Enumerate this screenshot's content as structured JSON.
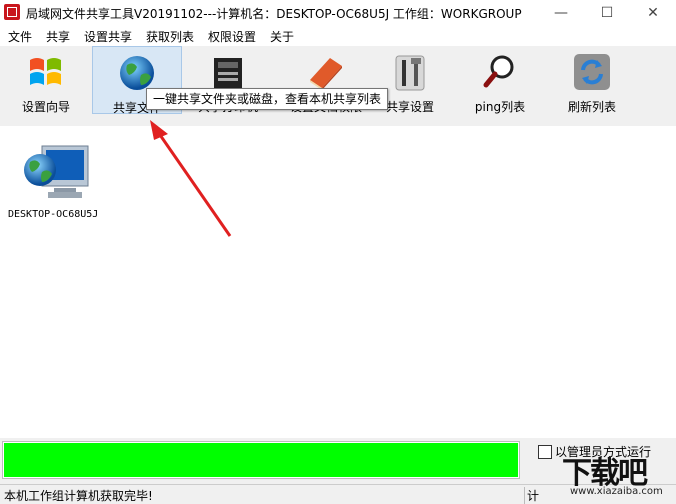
{
  "window": {
    "title": "局域网文件共享工具V20191102---计算机名：DESKTOP-OC68U5J  工作组：WORKGROUP",
    "minimize_glyph": "—",
    "maximize_glyph": "☐",
    "close_glyph": "✕"
  },
  "menu": {
    "items": [
      "文件",
      "共享",
      "设置共享",
      "获取列表",
      "权限设置",
      "关于"
    ]
  },
  "toolbar": {
    "items": [
      {
        "label": "设置向导",
        "icon": "windows-logo-icon"
      },
      {
        "label": "共享文件",
        "icon": "globe-icon"
      },
      {
        "label": "共享打印机",
        "icon": "printer-icon"
      },
      {
        "label": "设置文档权限",
        "icon": "book-icon"
      },
      {
        "label": "共享设置",
        "icon": "tools-icon"
      },
      {
        "label": "ping列表",
        "icon": "magnifier-icon"
      },
      {
        "label": "刷新列表",
        "icon": "refresh-icon"
      }
    ]
  },
  "tooltip": {
    "text": "一键共享文件夹或磁盘，查看本机共享列表"
  },
  "computers": [
    {
      "name": "DESKTOP-OC68U5J",
      "icon": "network-computer-icon"
    }
  ],
  "progress": {
    "fraction": 1.0,
    "color": "#00ff00"
  },
  "options": {
    "checkbox_label": "以管理员方式运行"
  },
  "status": {
    "left": "本机工作组计算机获取完毕!",
    "right": "计"
  },
  "watermark": {
    "text": "下载吧",
    "url": "www.xiazaiba.com"
  },
  "colors": {
    "accent_arrow": "#e02020",
    "toolbar_bg": "#f0f0f0",
    "selected_tool_bg": "#d8e7f5"
  }
}
